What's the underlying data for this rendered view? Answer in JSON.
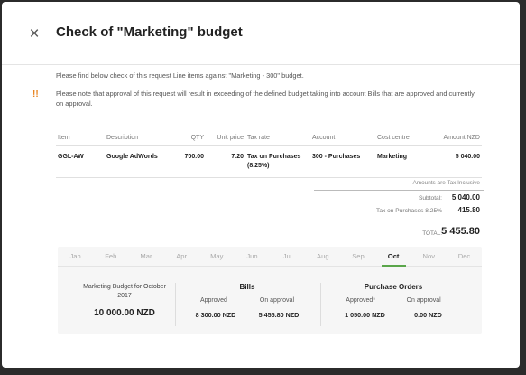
{
  "dialog": {
    "title": "Check of \"Marketing\" budget",
    "close_icon": "×",
    "intro": "Please find below check of this request Line items against \"Marketing - 300\" budget.",
    "warning_icon": "!!",
    "warning": "Please note that approval of this request will result in exceeding of the defined budget taking into account Bills that are approved and currently on approval."
  },
  "table": {
    "headers": [
      "Item",
      "Description",
      "QTY",
      "Unit price",
      "Tax rate",
      "Account",
      "Cost centre",
      "Amount NZD"
    ],
    "rows": [
      {
        "item": "GGL-AW",
        "description": "Google AdWords",
        "qty": "700.00",
        "unit_price": "7.20",
        "tax_rate": "Tax on Purchases (8.25%)",
        "account": "300 - Purchases",
        "cost_centre": "Marketing",
        "amount": "5 040.00"
      }
    ]
  },
  "totals": {
    "note": "Amounts are Tax Inclusive",
    "subtotal_label": "Subtotal:",
    "subtotal": "5 040.00",
    "tax_label": "Tax on Purchases 8.25%",
    "tax": "415.80",
    "total_label": "TOTAL:",
    "total": "5 455.80"
  },
  "budget": {
    "months": [
      "Jan",
      "Feb",
      "Mar",
      "Apr",
      "May",
      "Jun",
      "Jul",
      "Aug",
      "Sep",
      "Oct",
      "Nov",
      "Dec"
    ],
    "active_month": "Oct",
    "budget_label": "Marketing Budget for October 2017",
    "budget_value": "10 000.00 NZD",
    "bills": {
      "title": "Bills",
      "approved_label": "Approved",
      "approved": "8 300.00 NZD",
      "on_approval_label": "On approval",
      "on_approval": "5 455.80 NZD"
    },
    "purchase_orders": {
      "title": "Purchase Orders",
      "approved_label": "Approved*",
      "approved": "1 050.00 NZD",
      "on_approval_label": "On approval",
      "on_approval": "0.00 NZD"
    }
  },
  "colors": {
    "accent": "#5aa64a",
    "warning": "#e8831f"
  }
}
